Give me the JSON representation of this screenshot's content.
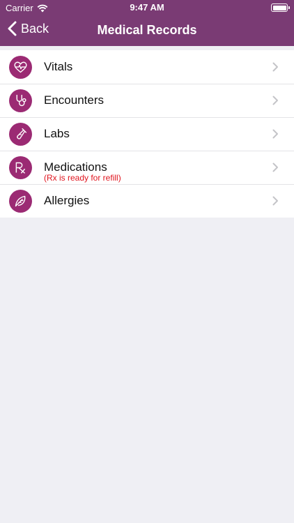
{
  "status_bar": {
    "carrier": "Carrier",
    "time": "9:47 AM"
  },
  "nav": {
    "back_label": "Back",
    "title": "Medical Records"
  },
  "colors": {
    "header": "#7a3b74",
    "icon_circle": "#9b2a73",
    "alert_text": "#e0141e"
  },
  "records": [
    {
      "label": "Vitals",
      "icon": "heart-pulse-icon"
    },
    {
      "label": "Encounters",
      "icon": "stethoscope-icon"
    },
    {
      "label": "Labs",
      "icon": "test-tube-icon"
    },
    {
      "label": "Medications",
      "icon": "rx-icon",
      "note": "(Rx is ready for refill)"
    },
    {
      "label": "Allergies",
      "icon": "leaf-icon"
    }
  ]
}
